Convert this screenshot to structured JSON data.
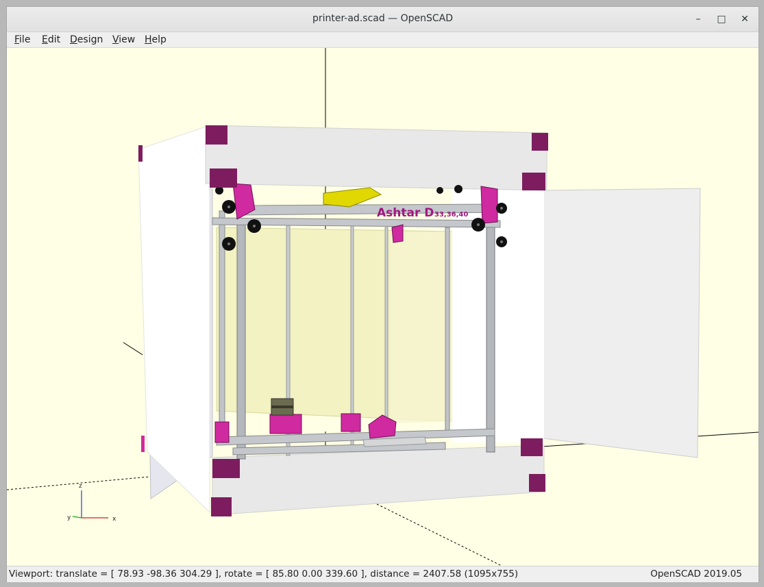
{
  "window": {
    "title": "printer-ad.scad — OpenSCAD",
    "controls": {
      "minimize": "–",
      "maximize": "□",
      "close": "✕"
    }
  },
  "menu": {
    "items": [
      {
        "accel": "F",
        "rest": "ile"
      },
      {
        "accel": "E",
        "rest": "dit"
      },
      {
        "accel": "D",
        "rest": "esign"
      },
      {
        "accel": "V",
        "rest": "iew"
      },
      {
        "accel": "H",
        "rest": "elp"
      }
    ]
  },
  "viewport": {
    "model_label": "Ashtar D",
    "model_label_sub": "33,36,40",
    "axis_labels": {
      "x": "x",
      "y": "y",
      "z": "z"
    },
    "colors": {
      "background": "#ffffe5",
      "corner_block": "#7d1d5f",
      "printed_part": "#d02aa0",
      "hotend": "#e0d800",
      "panel": "#f4f4f4",
      "aluminum": "#b4b8bd",
      "wheel": "#111111"
    }
  },
  "status": {
    "viewport": "Viewport: translate = [ 78.93 -98.36 304.29 ], rotate = [ 85.80 0.00 339.60 ], distance = 2407.58 (1095x755)",
    "version": "OpenSCAD 2019.05"
  }
}
